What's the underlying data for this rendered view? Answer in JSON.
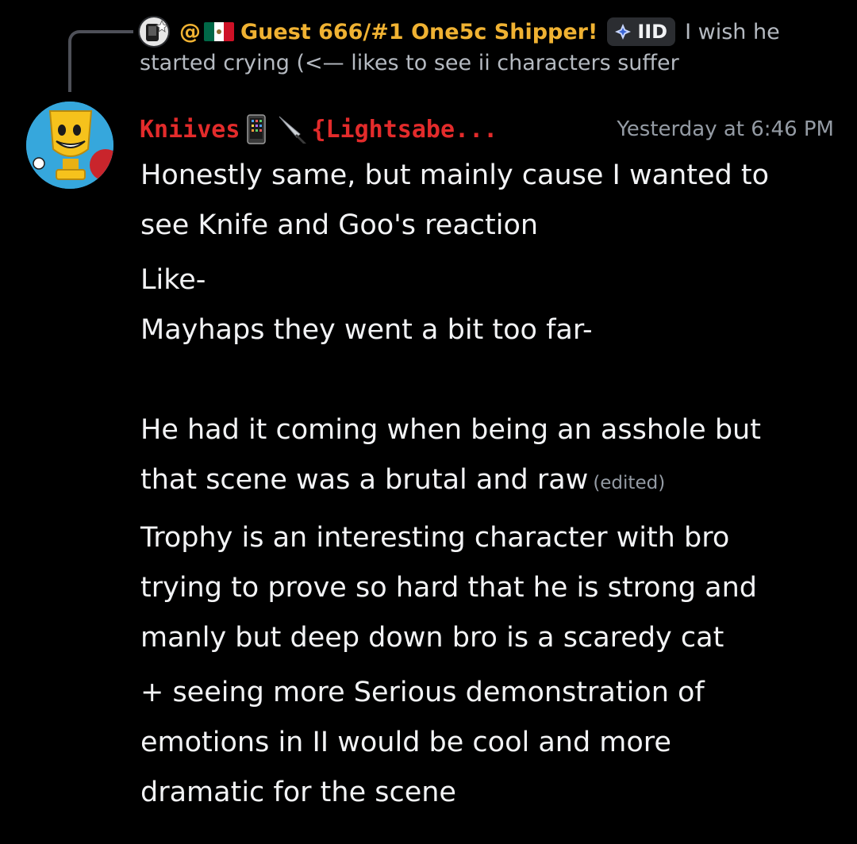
{
  "reply": {
    "author_prefix": "@",
    "author_name": "Guest 666/#1 One5c Shipper!",
    "tag_label": "IID",
    "text_line1": "I wish he",
    "text_line2": "started crying (<— likes to see ii characters suffer"
  },
  "message": {
    "username_part1": "Kniives",
    "username_part2": "{Lightsabe...",
    "timestamp": "Yesterday at 6:46 PM",
    "edited_label": "(edited)",
    "paragraphs": [
      {
        "lines": [
          "Honestly same, but mainly cause I wanted to",
          "see Knife and Goo's reaction"
        ]
      },
      {
        "lines": [
          "Like-",
          "Mayhaps they went a bit too far-",
          "",
          "He had it coming when being an asshole but",
          "that scene was a brutal and raw"
        ]
      },
      {
        "lines": [
          "Trophy is an interesting character with bro",
          "trying to prove so hard that he is strong and",
          "manly but deep down bro is a scaredy cat"
        ]
      },
      {
        "lines": [
          "+ seeing more Serious demonstration of",
          "emotions in II would be cool and more",
          "dramatic for the scene"
        ]
      }
    ]
  },
  "colors": {
    "background": "#000000",
    "reply_author": "#f0b232",
    "username": "#e32b2b",
    "timestamp": "#949ba4",
    "message_text": "#f2f3f5"
  },
  "icons": {
    "flag": "mexico-flag-icon",
    "tag": "sparkle-icon",
    "phone": "mobile-phone-icon",
    "knife": "knife-icon"
  }
}
